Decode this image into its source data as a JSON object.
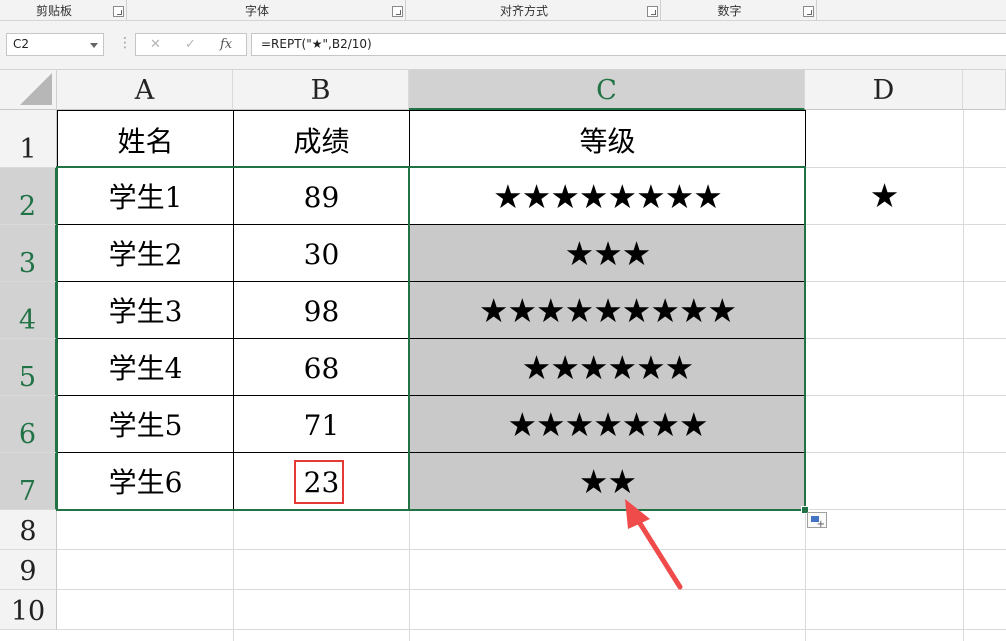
{
  "ribbon": {
    "groups": [
      {
        "label": "剪贴板"
      },
      {
        "label": "字体"
      },
      {
        "label": "对齐方式"
      },
      {
        "label": "数字"
      }
    ]
  },
  "formula_bar": {
    "name_box": "C2",
    "formula": "=REPT(\"★\",B2/10)",
    "cancel_icon": "✕",
    "enter_icon": "✓",
    "fx_label": "fx"
  },
  "columns": [
    "A",
    "B",
    "C",
    "D"
  ],
  "rows": [
    "1",
    "2",
    "3",
    "4",
    "5",
    "6",
    "7",
    "8",
    "9",
    "10"
  ],
  "table": {
    "headers": [
      "姓名",
      "成绩",
      "等级"
    ],
    "records": [
      {
        "name": "学生1",
        "score": "89",
        "grade": "★★★★★★★★"
      },
      {
        "name": "学生2",
        "score": "30",
        "grade": "★★★"
      },
      {
        "name": "学生3",
        "score": "98",
        "grade": "★★★★★★★★★"
      },
      {
        "name": "学生4",
        "score": "68",
        "grade": "★★★★★★"
      },
      {
        "name": "学生5",
        "score": "71",
        "grade": "★★★★★★★"
      },
      {
        "name": "学生6",
        "score": "23",
        "grade": "★★"
      }
    ],
    "d2": "★"
  },
  "selection": {
    "active_cell": "C2",
    "range": "C2:C7"
  },
  "annotations": {
    "highlighted_cell": "B7",
    "arrow_target": "C7"
  },
  "colors": {
    "accent_green": "#217346",
    "highlight_red": "#e53935",
    "selection_grey": "#c9c9c9"
  }
}
